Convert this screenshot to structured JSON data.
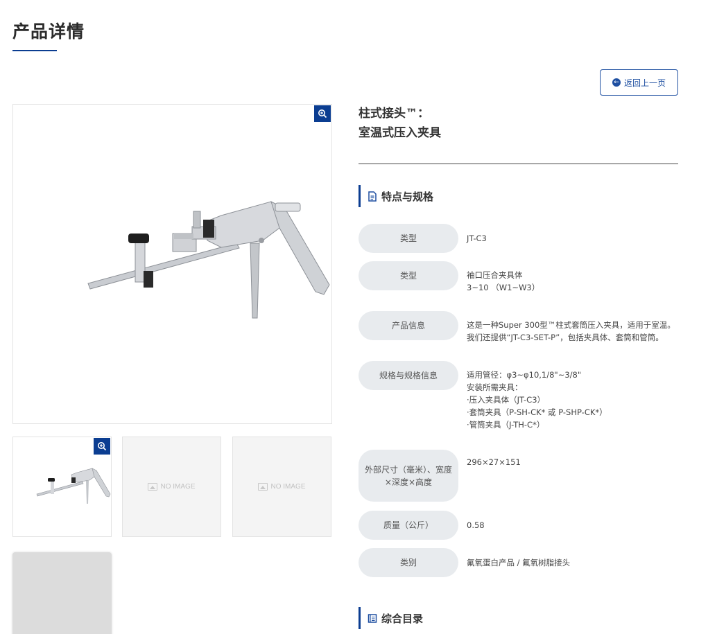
{
  "page": {
    "title": "产品详情"
  },
  "back_button": {
    "label": "返回上一页"
  },
  "product": {
    "title_line1": "柱式接头™：",
    "title_line2": "室温式压入夹具"
  },
  "gallery": {
    "no_image_text": "NO IMAGE"
  },
  "section_specs": {
    "title": "特点与规格"
  },
  "specs": [
    {
      "label": "类型",
      "value": "JT-C3"
    },
    {
      "label": "类型",
      "value": "袖口压合夹具体\n3~10 （W1~W3）"
    },
    {
      "label": "产品信息",
      "value": "这是一种Super 300型™柱式套筒压入夹具，适用于室温。\n我们还提供“JT-C3-SET-P”，包括夹具体、套筒和管筒。"
    },
    {
      "label": "规格与规格信息",
      "value": "适用管径：φ3~φ10,1/8\"~3/8\"\n安装所需夹具：\n·压入夹具体（JT-C3）\n·套筒夹具（P-SH-CK* 或 P-SHP-CK*）\n·管筒夹具（J-TH-C*）"
    },
    {
      "label": "外部尺寸（毫米）、宽度\n×深度×高度",
      "value": "296×27×151"
    },
    {
      "label": "质量（公斤）",
      "value": "0.58"
    },
    {
      "label": "类别",
      "value": "氟氧蛋白产品 / 氟氧树脂接头"
    }
  ],
  "section_catalog": {
    "title": "综合目录"
  },
  "colors": {
    "accent": "#0b3d91",
    "label_bg": "#e8ebee"
  }
}
